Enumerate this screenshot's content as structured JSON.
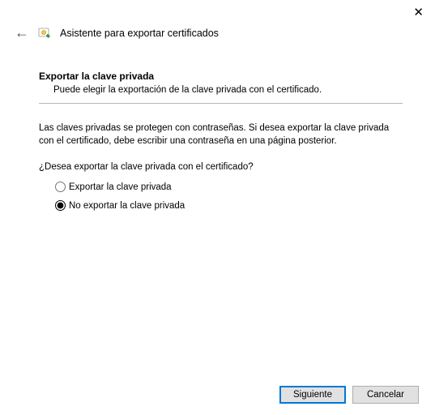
{
  "window": {
    "title": "Asistente para exportar certificados"
  },
  "section": {
    "heading": "Exportar la clave privada",
    "desc": "Puede elegir la exportación de la clave privada con el certificado."
  },
  "body": {
    "info": "Las claves privadas se protegen con contraseñas. Si desea exportar la clave privada con el certificado, debe escribir una contraseña en una página posterior.",
    "question": "¿Desea exportar la clave privada con el certificado?"
  },
  "options": {
    "export": "Exportar la clave privada",
    "no_export": "No exportar la clave privada",
    "selected": "no_export"
  },
  "buttons": {
    "next": "Siguiente",
    "cancel": "Cancelar"
  }
}
